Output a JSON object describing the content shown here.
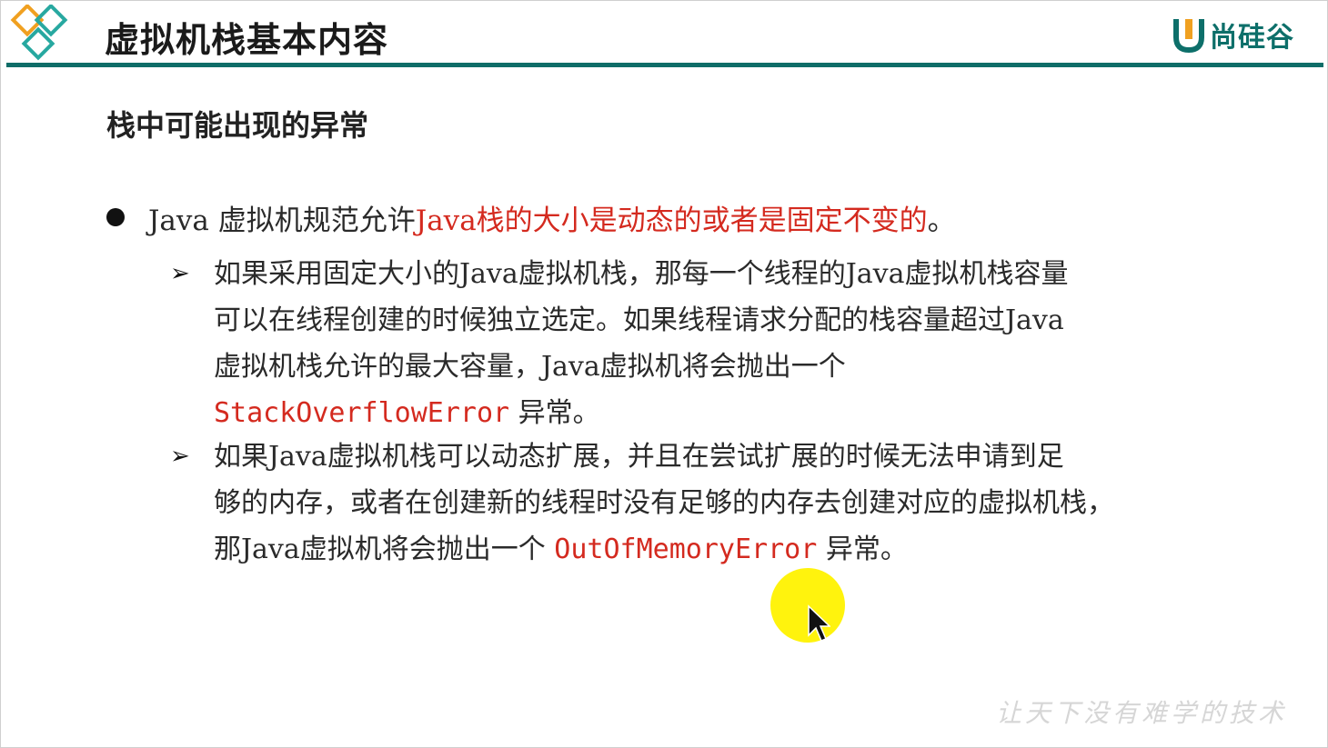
{
  "header": {
    "title": "虚拟机栈基本内容",
    "brand_name": "尚硅谷",
    "logo_icon": "diamond-logo-icon",
    "brand_icon": "u-brand-icon",
    "accent_color": "#0f6d68",
    "logo_color": "#f0a020"
  },
  "content": {
    "subtitle": "栈中可能出现的异常",
    "bullet": {
      "prefix": "Java 虚拟机规范允许",
      "highlight": "Java栈的大小是动态的或者是固定不变的",
      "suffix": "。"
    },
    "sub_items": [
      {
        "marker": "➢",
        "line1": "如果采用固定大小的Java虚拟机栈，那每一个线程的Java虚拟机栈容量",
        "line2": "可以在线程创建的时候独立选定。如果线程请求分配的栈容量超过Java",
        "line3": "虚拟机栈允许的最大容量，Java虚拟机将会抛出一个",
        "error_name": "StackOverflowError",
        "line4_suffix": " 异常。"
      },
      {
        "marker": "➢",
        "line1": "如果Java虚拟机栈可以动态扩展，并且在尝试扩展的时候无法申请到足",
        "line2": "够的内存，或者在创建新的线程时没有足够的内存去创建对应的虚拟机栈，",
        "line3_prefix": "那Java虚拟机将会抛出一个 ",
        "error_name": "OutOfMemoryError",
        "line3_suffix": " 异常。"
      }
    ],
    "highlight_color": "#d42a1f"
  },
  "watermark": "让天下没有难学的技术",
  "cursor": {
    "icon": "mouse-pointer-icon",
    "halo_color": "#fff200"
  }
}
